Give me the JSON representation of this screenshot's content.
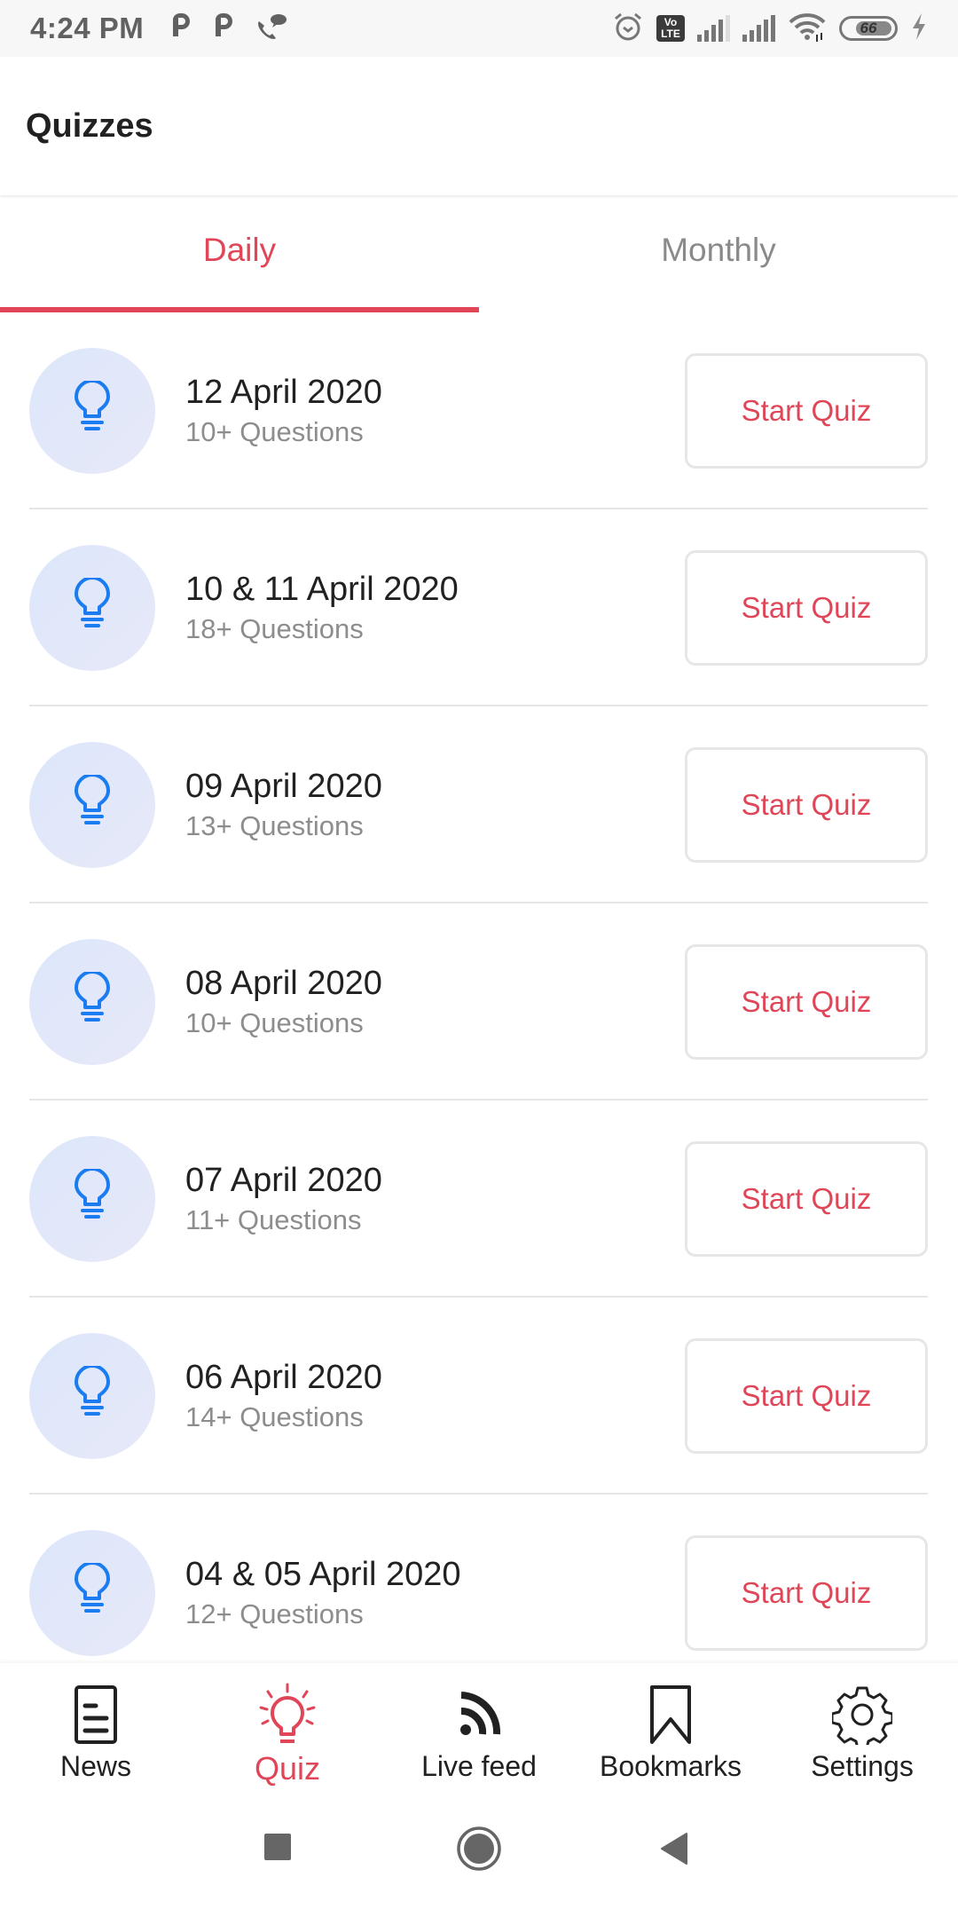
{
  "status_bar": {
    "time": "4:24 PM",
    "left_icons": [
      "p-app-icon",
      "p-app-icon",
      "wifi-calling-icon"
    ],
    "right_icons": [
      "alarm-icon",
      "volte-icon",
      "signal-icon",
      "signal-icon",
      "wifi-icon",
      "battery-icon",
      "charging-icon"
    ],
    "volte_label_top": "Vo",
    "volte_label_bottom": "LTE",
    "battery_level": "66"
  },
  "app_bar": {
    "title": "Quizzes"
  },
  "tabs": [
    {
      "label": "Daily",
      "active": true
    },
    {
      "label": "Monthly",
      "active": false
    }
  ],
  "quizzes": [
    {
      "date": "12 April 2020",
      "questions": "10+ Questions",
      "button": "Start Quiz"
    },
    {
      "date": "10 & 11 April 2020",
      "questions": "18+ Questions",
      "button": "Start Quiz"
    },
    {
      "date": "09 April 2020",
      "questions": "13+ Questions",
      "button": "Start Quiz"
    },
    {
      "date": "08 April 2020",
      "questions": "10+ Questions",
      "button": "Start Quiz"
    },
    {
      "date": "07 April 2020",
      "questions": "11+ Questions",
      "button": "Start Quiz"
    },
    {
      "date": "06 April 2020",
      "questions": "14+ Questions",
      "button": "Start Quiz"
    },
    {
      "date": "04 & 05 April 2020",
      "questions": "12+ Questions",
      "button": "Start Quiz"
    }
  ],
  "bottom_nav": [
    {
      "label": "News",
      "icon": "news-icon",
      "active": false
    },
    {
      "label": "Quiz",
      "icon": "lightbulb-icon",
      "active": true
    },
    {
      "label": "Live feed",
      "icon": "rss-icon",
      "active": false
    },
    {
      "label": "Bookmarks",
      "icon": "bookmark-icon",
      "active": false
    },
    {
      "label": "Settings",
      "icon": "gear-icon",
      "active": false
    }
  ],
  "system_nav": [
    "recents-button",
    "home-button",
    "back-button"
  ],
  "colors": {
    "accent": "#e04657",
    "icon_blue": "#1a7cf0",
    "icon_circle": "#dfe7fa",
    "muted_text": "#8d8d8d"
  }
}
